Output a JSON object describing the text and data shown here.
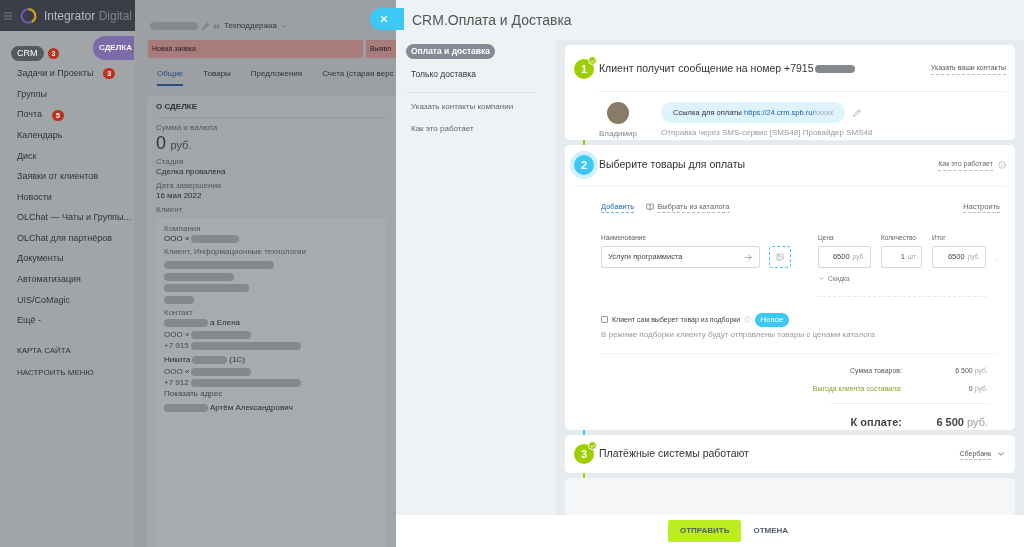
{
  "portal": {
    "logo_main": "Integrator",
    "logo_sub": "Digital"
  },
  "sidebar": {
    "items": [
      {
        "label": "CRM",
        "selected": true,
        "badge": "3"
      },
      {
        "label": "Задачи и Проекты",
        "selected": false,
        "badge": "3"
      },
      {
        "label": "Группы",
        "selected": false
      },
      {
        "label": "Почта",
        "selected": false,
        "badge": "5"
      },
      {
        "label": "Календарь",
        "selected": false
      },
      {
        "label": "Диск",
        "selected": false
      },
      {
        "label": "Заявки от клиентов",
        "selected": false
      },
      {
        "label": "Новости",
        "selected": false
      },
      {
        "label": "OLChat — Чаты и Группы...",
        "selected": false
      },
      {
        "label": "OLChat для партнёров",
        "selected": false
      },
      {
        "label": "Документы",
        "selected": false
      },
      {
        "label": "Автоматизация",
        "selected": false
      },
      {
        "label": "UIS/CoMagic",
        "selected": false
      },
      {
        "label": "Ещё -",
        "selected": false
      }
    ],
    "footer_links": [
      "КАРТА САЙТА",
      "НАСТРОИТЬ МЕНЮ"
    ]
  },
  "deal": {
    "badge": "СДЕЛКА",
    "category": "Техподдержка",
    "stages": [
      "Новая заявка",
      "Выявл"
    ],
    "tabs": [
      {
        "label": "Общие",
        "selected": true
      },
      {
        "label": "Товары",
        "selected": false
      },
      {
        "label": "Предложения",
        "selected": false
      },
      {
        "label": "Счета (старая верс",
        "selected": false
      }
    ],
    "section_title": "О СДЕЛКЕ",
    "amount_label": "Сумма и валюта",
    "amount": "0",
    "currency": "руб.",
    "stage_label": "Стадия",
    "stage": "Сделка провалена",
    "date_label": "Дата завершения",
    "date": "16 мая 2022",
    "client_label": "Клиент",
    "company_label": "Компания",
    "company": "ООО «",
    "company_type": "Клиент, Информационные технологии",
    "contact_label": "Контакт",
    "contacts": [
      {
        "name": "а Елена",
        "org": "ООО «",
        "phone": "+7 915"
      },
      {
        "name": "Никита",
        "name_tail": "(1С)",
        "org": "ООО «",
        "phone": "+7 912",
        "address_link": "Показать адрес"
      },
      {
        "name": "Артём Александрович"
      }
    ]
  },
  "slider": {
    "title": "CRM.Оплата и Доставка",
    "nav": [
      {
        "label": "Оплата и доставка",
        "selected": true
      },
      {
        "label": "Только доставка",
        "selected": false
      }
    ],
    "links": [
      "Указать контакты компании",
      "Как это работает"
    ]
  },
  "step1": {
    "number": "1",
    "done": true,
    "current": false,
    "title": "Клиент получит сообщение на номер +7915",
    "link": "Указать ваши контакты",
    "sender": "Владимир",
    "message": "Ссылка для оплаты",
    "url": "https://24.crm.spb.ru/",
    "url_tail": "xxxxx",
    "note": "Отправка через SMS-сервис [SMS48] Провайдер SMS48"
  },
  "step2": {
    "number": "2",
    "done": false,
    "current": true,
    "title": "Выберите товары для оплаты",
    "help_link": "Как это работает",
    "add_link": "Добавить",
    "catalog_link": "Выбрать из каталога",
    "settings_link": "Настроить",
    "product": {
      "name_label": "Наименование",
      "name": "Услуги программиста",
      "price_label": "Цена",
      "price": "6500",
      "price_unit": "руб.",
      "qty_label": "Количество",
      "qty": "1",
      "qty_unit": "шт",
      "total_label": "Итог",
      "total": "6500",
      "total_unit": "руб.",
      "discount": "Скидка"
    },
    "selection": {
      "label": "Клиент сам выберет товар из подборки",
      "checked": false,
      "badge": "Новое",
      "hint": "В режиме подборки клиенту будут отправлены товары с ценами каталога"
    },
    "summary": [
      {
        "label": "Сумма товаров:",
        "value": "6 500",
        "unit": "руб.",
        "kind": "plain"
      },
      {
        "label": "Выгода клиента составила:",
        "value": "0",
        "unit": "руб.",
        "kind": "benefit"
      }
    ],
    "total_label": "К оплате:",
    "total": "6 500",
    "total_unit": "руб."
  },
  "step3": {
    "number": "3",
    "done": true,
    "current": false,
    "title": "Платёжные системы работают",
    "provider": "Сбербанк"
  },
  "buttons": [
    {
      "label": "ОТПРАВИТЬ",
      "kind": "primary"
    },
    {
      "label": "ОТМЕНА",
      "kind": "link"
    }
  ]
}
